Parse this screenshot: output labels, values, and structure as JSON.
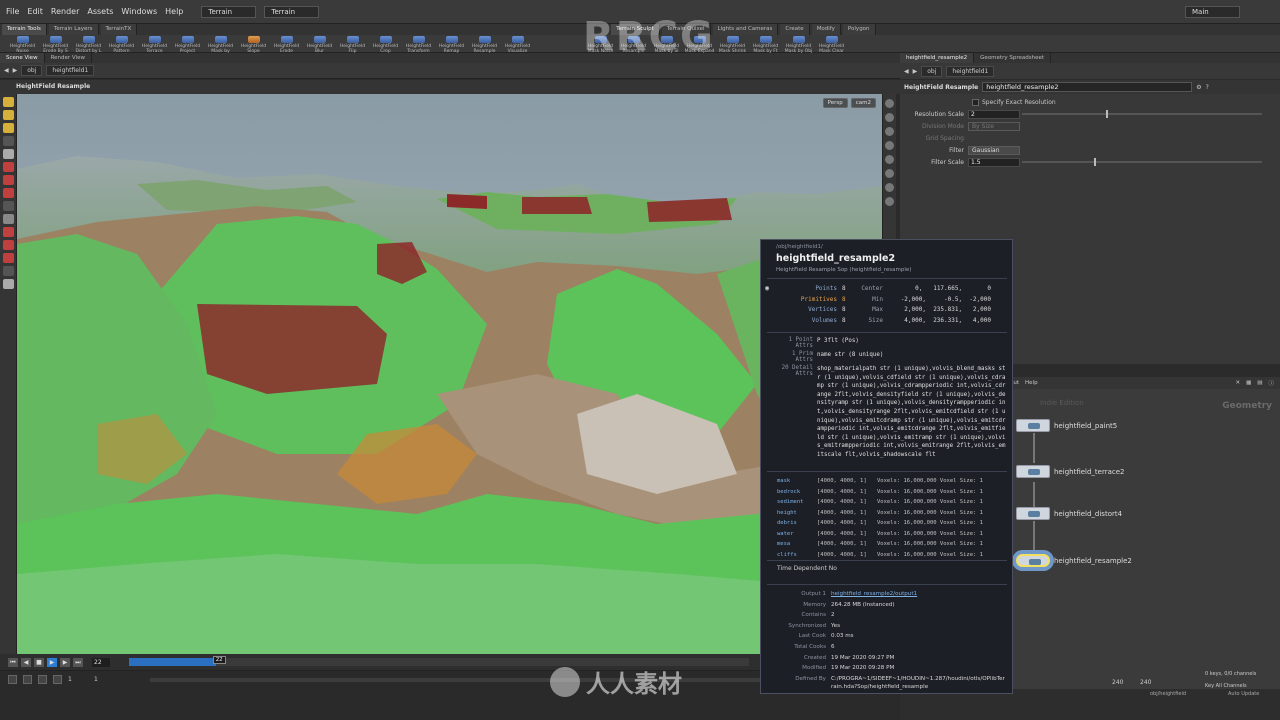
{
  "menubar": {
    "items": [
      "File",
      "Edit",
      "Render",
      "Assets",
      "Windows",
      "Help"
    ],
    "desktop_left": "Terrain",
    "desktop_right": "Terrain",
    "desktop_main": "Main"
  },
  "shelf": {
    "tabs": [
      "Terrain Tools",
      "Terrain Layers",
      "TerrainTX"
    ],
    "tabs_right": [
      "Terrain Sculpt",
      "Terrain Quixel",
      "Lights and Cameras",
      "Create",
      "Modify",
      "Polygon"
    ],
    "tools": [
      "HeightField Noise",
      "HeightField Erode By S",
      "HeightField Distort by L",
      "HeightField Pattern",
      "HeightField Terrace",
      "HeightField Project",
      "HeightField Mask by",
      "HeightField Slope",
      "HeightField Erode",
      "HeightField Blur",
      "HeightField Flip",
      "HeightField Crop",
      "HeightField Transform",
      "HeightField Remap",
      "HeightField Resample",
      "HeightField Visualize"
    ],
    "tools_right": [
      "HeightField Mask Noise",
      "HeightField Resample",
      "HeightField Mask by Sl",
      "HeightField Mask Expand",
      "HeightField Mask Shrink",
      "HeightField Mask by Ft",
      "HeightField Mask by Obj",
      "HeightField Mask Clear"
    ]
  },
  "left_panel": {
    "tabs": [
      "Scene View",
      "Render View"
    ],
    "path": [
      "obj",
      "heightfield1"
    ],
    "header": "HeightField Resample",
    "cam_persp": "Persp",
    "cam_name": "cam2"
  },
  "timeline": {
    "frame": "22",
    "cursor_label": "22",
    "progress": 0.14,
    "range_start": "1",
    "range_start2": "1",
    "range_end": "240",
    "range_end2": "240"
  },
  "right_panel": {
    "tabs": [
      "heightfield_resample2",
      "Geometry Spreadsheet"
    ],
    "path": [
      "obj",
      "heightfield1"
    ],
    "node_type": "HeightField Resample",
    "node_name": "heightfield_resample2"
  },
  "params": {
    "specify_exact": "Specify Exact Resolution",
    "resolution_scale_label": "Resolution Scale",
    "resolution_scale_value": "2",
    "resolution_scale_fraction": 0.35,
    "division_mode_label": "Division Mode",
    "division_mode_value": "By Size",
    "grid_spacing_label": "Grid Spacing",
    "filter_label": "Filter",
    "filter_value": "Gaussian",
    "filter_scale_label": "Filter Scale",
    "filter_scale_value": "1.5",
    "filter_scale_fraction": 0.3
  },
  "network": {
    "help": "Help",
    "layout": "out",
    "context": "Geometry",
    "badge": "Indie Edition",
    "nodes": [
      "heightfield_paint5",
      "heightfield_terrace2",
      "heightfield_distort4",
      "heightfield_resample2"
    ],
    "footer_keys": "0 keys, 0/0 channels",
    "footer_key_all": "Key All Channels",
    "footer_path": "obj/heightfield",
    "footer_auto": "Auto Update"
  },
  "info": {
    "path": "/obj/heightfield1/",
    "title": "heightfield_resample2",
    "subtitle": "HeightField Resample Sop (heightfield_resample)",
    "stats": [
      {
        "label": "Points",
        "value": "8",
        "clabel": "Center",
        "cvalue": "0,   117.665,       0",
        "hl": false
      },
      {
        "label": "Primitives",
        "value": "8",
        "clabel": "Min",
        "cvalue": "-2,000,     -0.5,  -2,000",
        "hl": true
      },
      {
        "label": "Vertices",
        "value": "8",
        "clabel": "Max",
        "cvalue": "2,000,  235.831,   2,000",
        "hl": false
      },
      {
        "label": "Volumes",
        "value": "8",
        "clabel": "Size",
        "cvalue": "4,000,  236.331,   4,000",
        "hl": false
      }
    ],
    "point_attrs_label": "1 Point Attrs",
    "point_attrs": "P 3flt (Pos)",
    "prim_attrs_label": "1 Prim Attrs",
    "prim_attrs": "name str (8 unique)",
    "detail_attrs_label": "20 Detail Attrs",
    "detail_attrs": "shop_materialpath str (1 unique),volvis_blend_masks str (1 unique),volvis_cdfield str (1 unique),volvis_cdramp str (1 unique),volvis_cdrampperiodic int,volvis_cdrange 2flt,volvis_densityfield str (1 unique),volvis_densityramp str (1 unique),volvis_densityrampperiodic int,volvis_densityrange 2flt,volvis_emitcdfield str (1 unique),volvis_emitcdramp str (1 unique),volvis_emitcdrampperiodic int,volvis_emitcdrange 2flt,volvis_emitfield str (1 unique),volvis_emitramp str (1 unique),volvis_emitrampperiodic int,volvis_emitrange 2flt,volvis_emitscale flt,volvis_shadowscale flt",
    "volumes": [
      {
        "name": "mask",
        "res": "[4000, 4000, 1]",
        "info": "Voxels: 16,000,000 Voxel Size: 1"
      },
      {
        "name": "bedrock",
        "res": "[4000, 4000, 1]",
        "info": "Voxels: 16,000,000 Voxel Size: 1"
      },
      {
        "name": "sediment",
        "res": "[4000, 4000, 1]",
        "info": "Voxels: 16,000,000 Voxel Size: 1"
      },
      {
        "name": "height",
        "res": "[4000, 4000, 1]",
        "info": "Voxels: 16,000,000 Voxel Size: 1"
      },
      {
        "name": "debris",
        "res": "[4000, 4000, 1]",
        "info": "Voxels: 16,000,000 Voxel Size: 1"
      },
      {
        "name": "water",
        "res": "[4000, 4000, 1]",
        "info": "Voxels: 16,000,000 Voxel Size: 1"
      },
      {
        "name": "mesa",
        "res": "[4000, 4000, 1]",
        "info": "Voxels: 16,000,000 Voxel Size: 1"
      },
      {
        "name": "cliffs",
        "res": "[4000, 4000, 1]",
        "info": "Voxels: 16,000,000 Voxel Size: 1"
      }
    ],
    "time_dependent_label": "Time Dependent",
    "time_dependent": "No",
    "meta": [
      {
        "label": "Output 1",
        "value": "heightfield_resample2/output1",
        "kind": "link"
      },
      {
        "label": "Memory",
        "value": "264.28 MB (Instanced)",
        "kind": ""
      },
      {
        "label": "Contains",
        "value": "2",
        "kind": ""
      },
      {
        "label": "Synchronized",
        "value": "Yes",
        "kind": ""
      },
      {
        "label": "Last Cook",
        "value": "0.03 ms",
        "kind": ""
      },
      {
        "label": "Total Cooks",
        "value": "6",
        "kind": ""
      },
      {
        "label": "Created",
        "value": "19 Mar 2020 09:27 PM",
        "kind": ""
      },
      {
        "label": "Modified",
        "value": "19 Mar 2020 09:28 PM",
        "kind": ""
      },
      {
        "label": "Defined By",
        "value": "C:/PROGRA~1/SIDEEF~1/HOUDIN~1.287/houdini/otls/OPlibTerrain.hda?Sop/heightfield_resample",
        "kind": "wrap"
      }
    ]
  },
  "watermark": {
    "top": "RRCG",
    "bottom": "人人素材"
  },
  "colors": {
    "accent": "#2d7dd2",
    "selected_ring": "#6f97c8",
    "terrain_green": "#5cc35a",
    "terrain_red": "#8c2a2a"
  }
}
